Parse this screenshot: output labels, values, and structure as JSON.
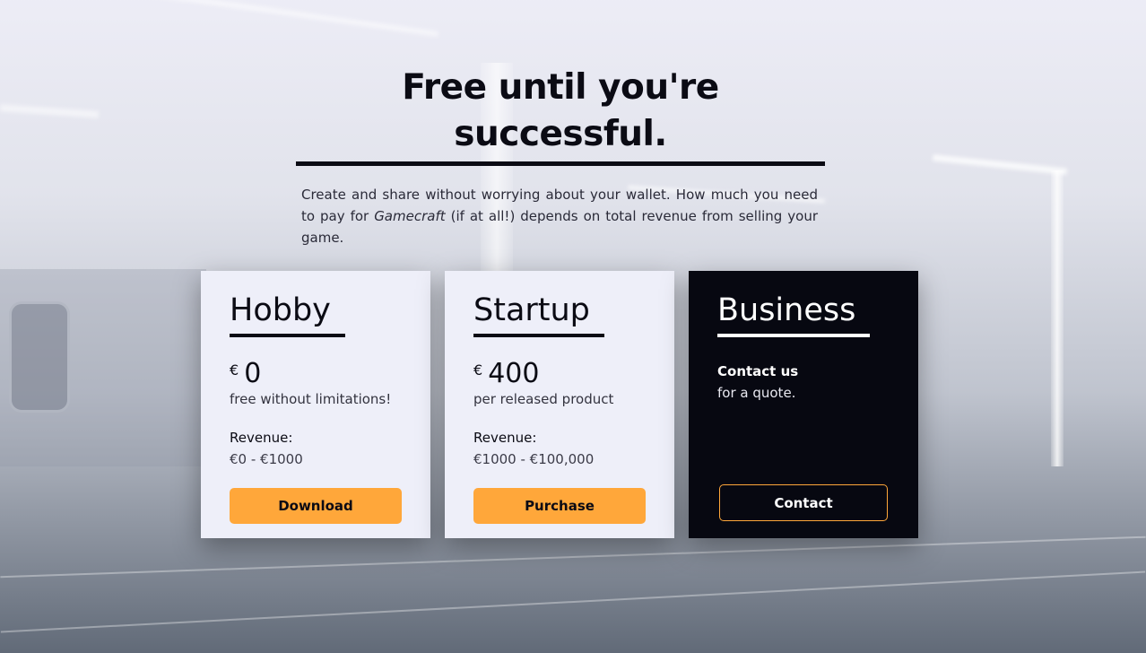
{
  "header": {
    "title": "Free until you're successful.",
    "intro_before": "Create and share without worrying about your wallet. How much you need to pay for ",
    "intro_product": "Gamecraft",
    "intro_after": " (if at all!) depends on total revenue from selling your game."
  },
  "plans": [
    {
      "name": "Hobby",
      "currency": "€",
      "amount": "0",
      "note": "free without limitations!",
      "revenue_label": "Revenue:",
      "revenue_range": "€0 - €1000",
      "button_label": "Download"
    },
    {
      "name": "Startup",
      "currency": "€",
      "amount": "400",
      "note": "per released product",
      "revenue_label": "Revenue:",
      "revenue_range": "€1000 - €100,000",
      "button_label": "Purchase"
    },
    {
      "name": "Business",
      "contact_strong": "Contact us",
      "contact_note": "for a quote.",
      "button_label": "Contact"
    }
  ],
  "colors": {
    "accent": "#ffa73a",
    "card_light": "#eeeff9",
    "card_dark": "#070811",
    "text_dark": "#0b0b14"
  }
}
